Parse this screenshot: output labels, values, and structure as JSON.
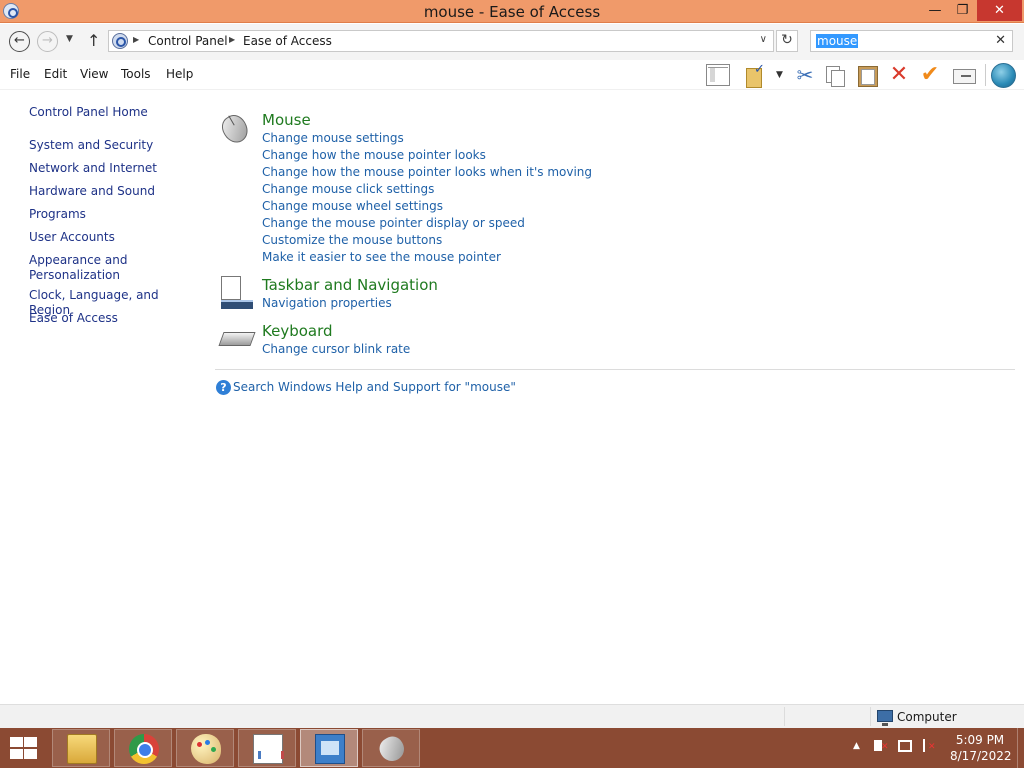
{
  "window": {
    "title": "mouse - Ease of Access",
    "minimize_glyph": "—",
    "restore_glyph": "❐",
    "close_glyph": "✕"
  },
  "address": {
    "back_glyph": "←",
    "forward_glyph": "→",
    "recent_glyph": "▼",
    "up_glyph": "↑",
    "breadcrumbs": [
      "Control Panel",
      "Ease of Access"
    ],
    "separator_glyph": "▶",
    "dropdown_glyph": "∨",
    "refresh_glyph": "↻"
  },
  "search": {
    "value": "mouse",
    "clear_glyph": "✕"
  },
  "menu": {
    "items": [
      "File",
      "Edit",
      "View",
      "Tools",
      "Help"
    ]
  },
  "toolbar": {
    "cut_glyph": "✂",
    "delete_glyph": "✕",
    "check_glyph": "✔",
    "drop_glyph": "▼"
  },
  "leftnav": {
    "items": [
      "Control Panel Home",
      "System and Security",
      "Network and Internet",
      "Hardware and Sound",
      "Programs",
      "User Accounts",
      "Appearance and Personalization",
      "Clock, Language, and Region",
      "Ease of Access"
    ]
  },
  "results": {
    "groups": [
      {
        "title": "Mouse",
        "icon": "mouse-icon",
        "tasks": [
          "Change mouse settings",
          "Change how the mouse pointer looks",
          "Change how the mouse pointer looks when it's moving",
          "Change mouse click settings",
          "Change mouse wheel settings",
          "Change the mouse pointer display or speed",
          "Customize the mouse buttons",
          "Make it easier to see the mouse pointer"
        ]
      },
      {
        "title": "Taskbar and Navigation",
        "icon": "taskbar-navigation-icon",
        "tasks": [
          "Navigation properties"
        ]
      },
      {
        "title": "Keyboard",
        "icon": "keyboard-icon",
        "tasks": [
          "Change cursor blink rate"
        ]
      }
    ],
    "help_glyph": "?",
    "help_link": "Search Windows Help and Support for \"mouse\""
  },
  "statusbar": {
    "location": "Computer"
  },
  "taskbar": {
    "apps": [
      {
        "name": "file-explorer",
        "active": false
      },
      {
        "name": "chrome",
        "active": false
      },
      {
        "name": "paint",
        "active": false
      },
      {
        "name": "performance-monitor",
        "active": false
      },
      {
        "name": "control-panel",
        "active": true
      },
      {
        "name": "mouse-properties",
        "active": false
      }
    ],
    "tray_up_glyph": "▲",
    "time": "5:09 PM",
    "date": "8/17/2022"
  },
  "colors": {
    "titlebar": "#f09a6a",
    "taskbar": "#8b4a33",
    "link": "#1f61a8",
    "group_title": "#1f7a1f",
    "nav_link": "#1e3287",
    "close_button": "#c7372f"
  }
}
